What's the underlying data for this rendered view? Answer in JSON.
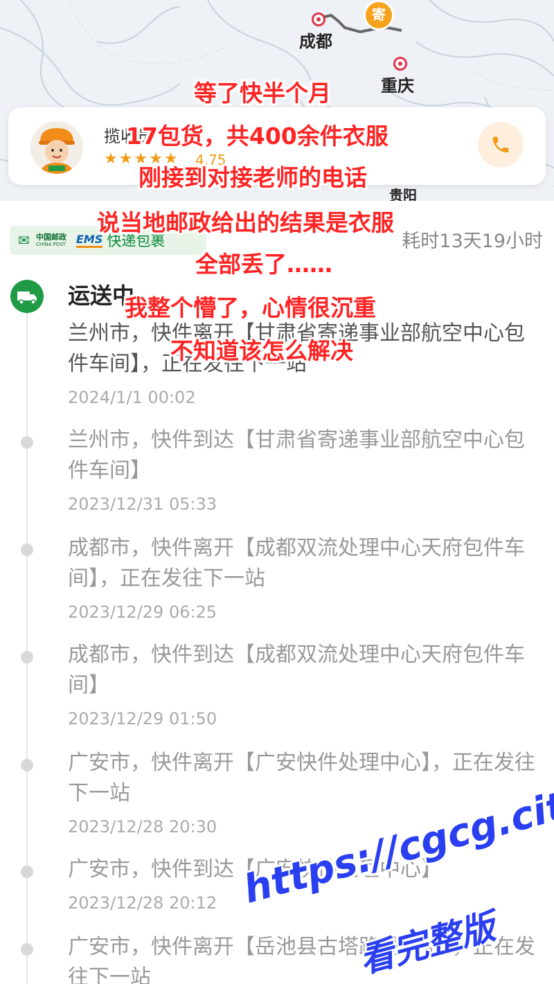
{
  "map": {
    "cities": [
      {
        "name": "成都"
      },
      {
        "name": "重庆"
      },
      {
        "name": "贵阳"
      }
    ],
    "courier_pin_glyph": "寄",
    "route_color": "#666666"
  },
  "courier": {
    "name": "揽收员",
    "stars": "★★★★★",
    "rating": "4.75",
    "call_icon": "phone-icon"
  },
  "carrier": {
    "china_post_cn": "中国邮政",
    "china_post_en": "CHINA POST",
    "ems": "EMS",
    "type": "快递包裹",
    "duration": "耗时13天19小时"
  },
  "status": {
    "title": "运送中"
  },
  "events": [
    {
      "desc": "兰州市，快件离开【甘肃省寄递事业部航空中心包件车间】，正在发往下一站",
      "time": "2024/1/1 00:02"
    },
    {
      "desc": "兰州市，快件到达【甘肃省寄递事业部航空中心包件车间】",
      "time": "2023/12/31 05:33"
    },
    {
      "desc": "成都市，快件离开【成都双流处理中心天府包件车间】，正在发往下一站",
      "time": "2023/12/29 06:25"
    },
    {
      "desc": "成都市，快件到达【成都双流处理中心天府包件车间】",
      "time": "2023/12/29 01:50"
    },
    {
      "desc": "广安市，快件离开【广安快件处理中心】，正在发往下一站",
      "time": "2023/12/28 20:30"
    },
    {
      "desc": "广安市，快件到达【广安快件处理中心】",
      "time": "2023/12/28 20:12"
    },
    {
      "desc": "广安市，快件离开【岳池县古塔路揽投部】，正在发往下一站",
      "time": ""
    }
  ],
  "captions": [
    "等了快半个月",
    "17包货，共400余件衣服",
    "刚接到对接老师的电话",
    "说当地邮政给出的结果是衣服",
    "全部丢了……",
    "我整个懵了，心情很沉重",
    "不知道该怎么解决"
  ],
  "watermark": {
    "url": "https://cgcg.city",
    "text": "看完整版"
  },
  "colors": {
    "accent_orange": "#f29a14",
    "post_green": "#1f9a45",
    "caption_red": "#ff2424",
    "watermark_blue": "#2a3ff0"
  }
}
